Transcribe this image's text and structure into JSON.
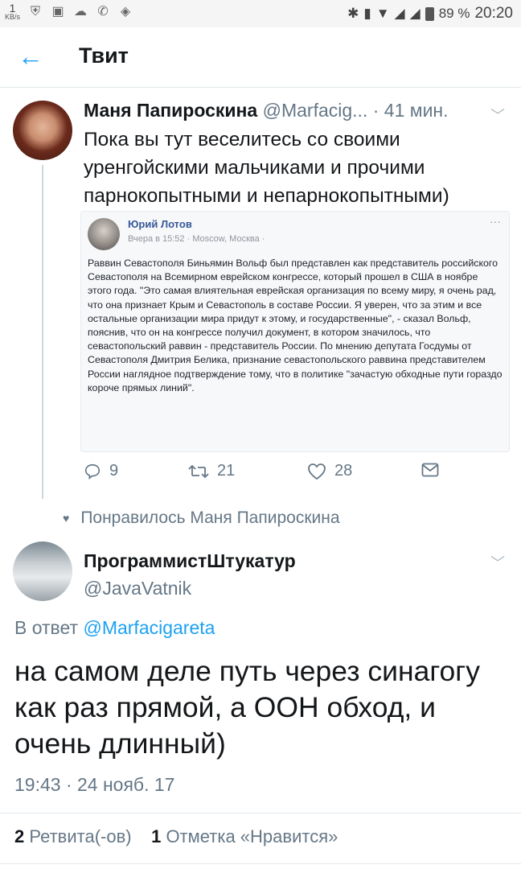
{
  "status_bar": {
    "net_speed": "1",
    "net_unit": "KB/s",
    "battery": "89 %",
    "time": "20:20"
  },
  "header": {
    "title": "Твит"
  },
  "tweet1": {
    "author_name": "Маня Папироскина",
    "handle": "@Marfacig...",
    "time": "41 мин.",
    "text": "Пока вы тут веселитесь со своими уренгойскими мальчиками и прочими парнокопытными и непарнокопытными)",
    "embed": {
      "author": "Юрий Лотов",
      "meta": "Вчера в 15:52 · Moscow, Москва ·",
      "dots": "···",
      "body": "Раввин Севастополя Биньямин Вольф был представлен как представитель российского Севастополя на Всемирном еврейском конгрессе, который прошел в США в ноябре этого года. \"Это самая влиятельная еврейская организация по всему миру, я очень рад, что она признает Крым и Севастополь в составе России. Я уверен, что за этим и все остальные организации мира придут к этому, и государственные\", - сказал Вольф, пояснив, что он на конгрессе получил документ, в котором значилось, что севастопольский раввин - представитель России. По мнению депутата Госдумы от Севастополя Дмитрия Белика, признание севастопольского раввина представителем России наглядное подтверждение тому, что в политике \"зачастую обходные пути гораздо короче прямых линий\"."
    },
    "replies": "9",
    "retweets": "21",
    "likes": "28"
  },
  "liked_by": "Понравилось Маня Папироскина",
  "tweet2": {
    "author_name": "ПрограммистШтукатур",
    "handle": "@JavaVatnik",
    "reply_prefix": "В ответ",
    "reply_to": "@Marfacigareta",
    "text": "на самом деле путь через синагогу как раз прямой, а ООН обход, и очень длинный)",
    "timestamp": "19:43 · 24 нояб. 17",
    "retweets_count": "2",
    "retweets_label": "Ретвита(-ов)",
    "likes_count": "1",
    "likes_label": "Отметка «Нравится»"
  }
}
